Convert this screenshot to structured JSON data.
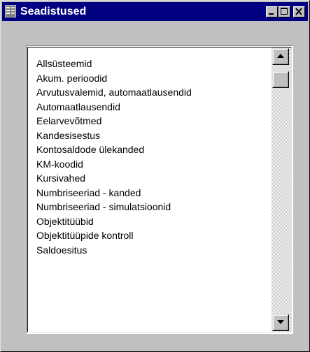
{
  "window": {
    "title": "Seadistused",
    "icon": "settings-app-icon",
    "controls": [
      "minimize-icon",
      "maximize-icon",
      "close-icon"
    ]
  },
  "list": {
    "items": [
      "Allsüsteemid",
      "Akum. perioodid",
      "Arvutusvalemid, automaatlausendid",
      "Automaatlausendid",
      "Eelarvevõtmed",
      "Kandesisestus",
      "Kontosaldode ülekanded",
      "KM-koodid",
      "Kursivahed",
      "Numbriseeriad - kanded",
      "Numbriseeriad - simulatsioonid",
      "Objektitüübid",
      "Objektitüüpide kontroll",
      "Saldoesitus"
    ]
  },
  "colors": {
    "titlebar": "#000080",
    "title_text": "#ffffff",
    "window_face": "#c0c0c0",
    "list_background": "#ffffff"
  }
}
